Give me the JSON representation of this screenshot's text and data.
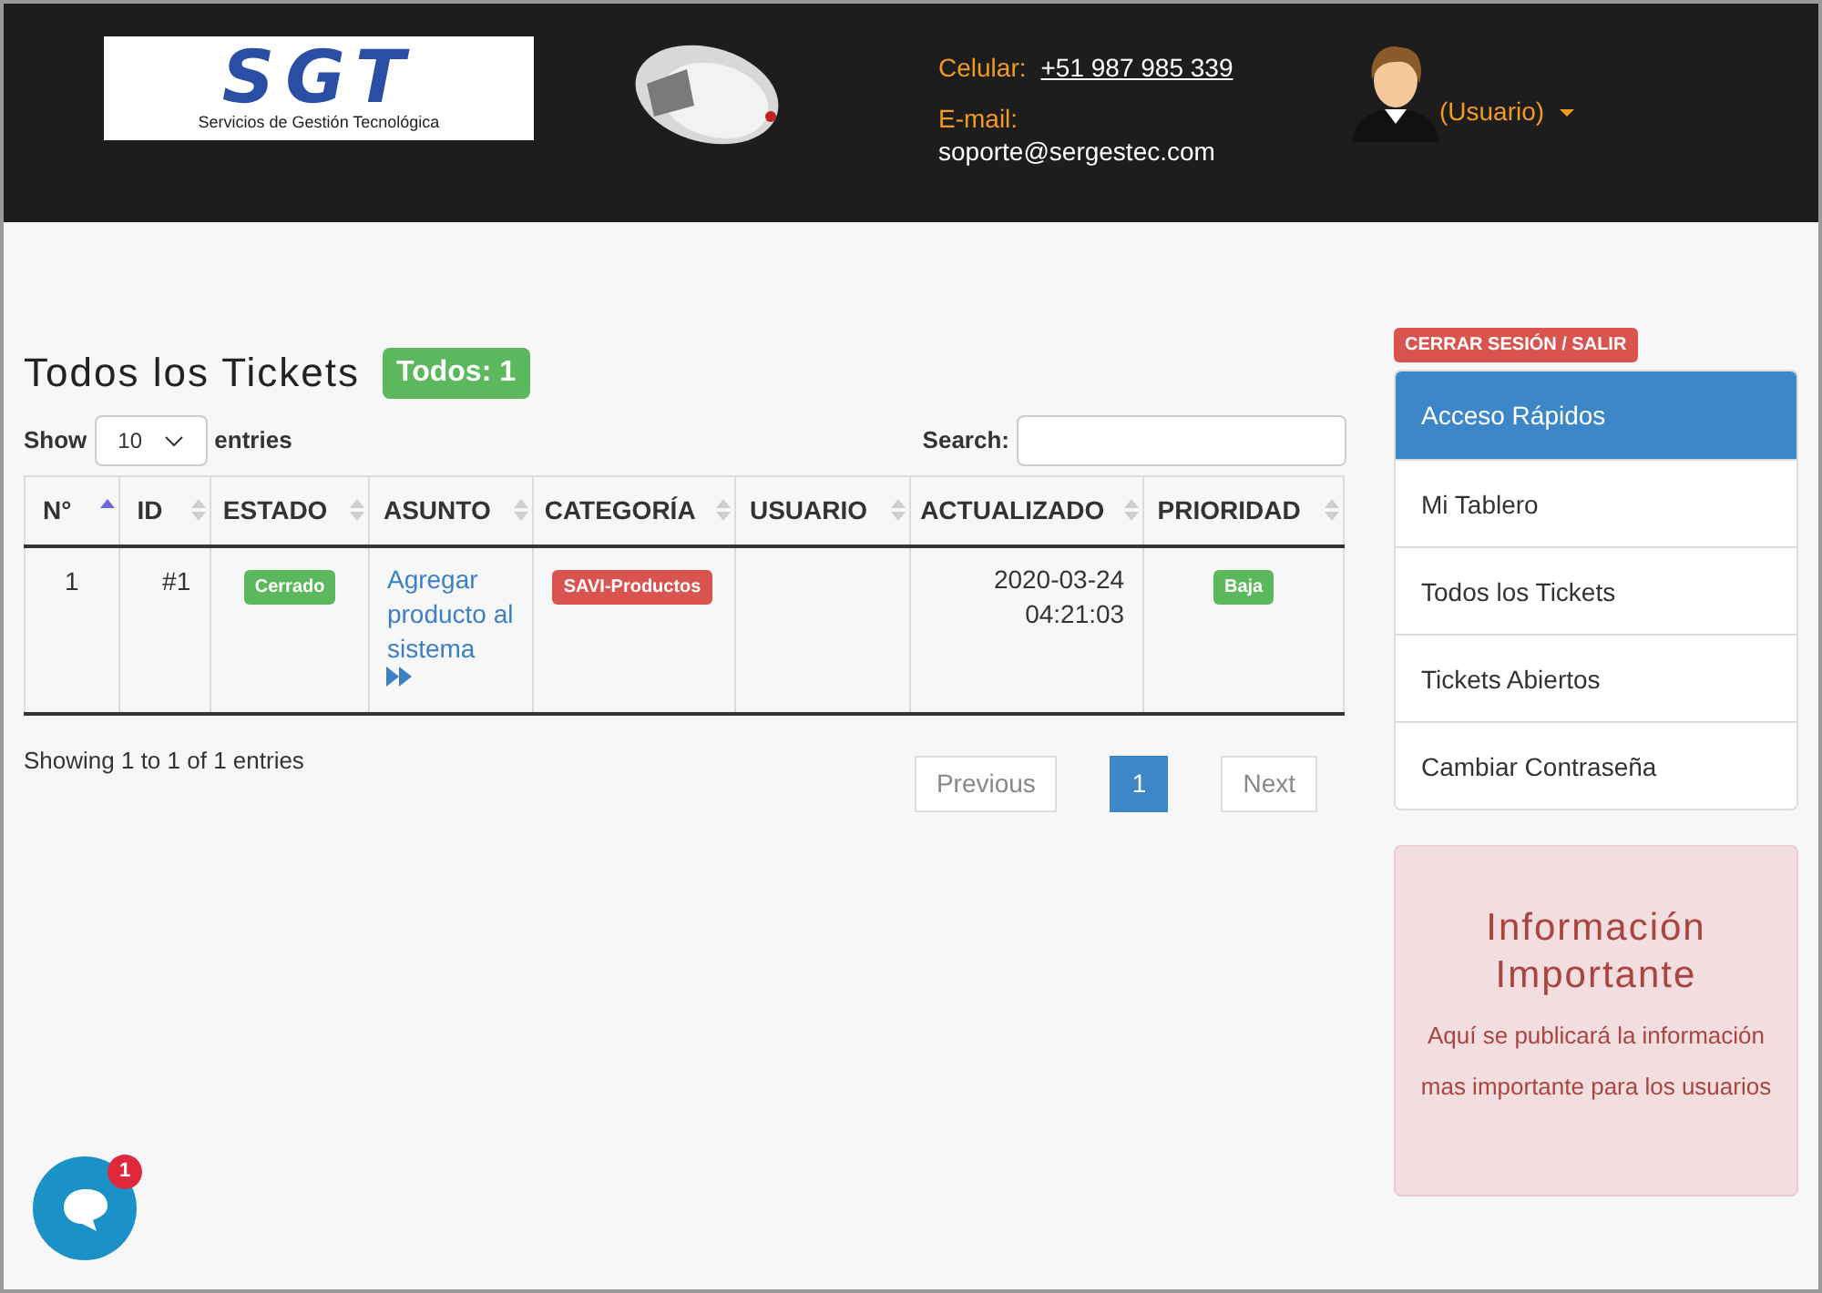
{
  "header": {
    "logo": {
      "mark": "SGT",
      "tagline": "Servicios de Gestión Tecnológica"
    },
    "phone_label": "Celular:",
    "phone": "+51 987 985 339",
    "email_label": "E-mail:",
    "email": "soporte@sergestec.com",
    "user_menu": "(Usuario)"
  },
  "page": {
    "title": "Todos los Tickets",
    "count_badge": "Todos: 1"
  },
  "length_control": {
    "before": "Show",
    "value": "10",
    "after": "entries"
  },
  "search": {
    "label": "Search:"
  },
  "table": {
    "columns": [
      {
        "label": "N°",
        "sorted": true
      },
      {
        "label": "ID",
        "sorted": false
      },
      {
        "label": "ESTADO",
        "sorted": false
      },
      {
        "label": "ASUNTO",
        "sorted": false
      },
      {
        "label": "CATEGORÍA",
        "sorted": false
      },
      {
        "label": "USUARIO",
        "sorted": false
      },
      {
        "label": "ACTUALIZADO",
        "sorted": false
      },
      {
        "label": "PRIORIDAD",
        "sorted": false
      }
    ],
    "rows": [
      {
        "n": "1",
        "id": "#1",
        "estado": {
          "text": "Cerrado",
          "color": "#5cb85c"
        },
        "asunto": "Agregar producto al sistema",
        "categoria": {
          "text": "SAVI-Productos",
          "color": "#d9534f"
        },
        "actualizado_date": "2020-03-24",
        "actualizado_time": "04:21:03",
        "prioridad": {
          "text": "Baja",
          "color": "#5cb85c"
        }
      }
    ]
  },
  "info": "Showing 1 to 1 of 1 entries",
  "pagination": [
    {
      "label": "Previous",
      "disabled": true,
      "selected": false
    },
    {
      "label": "1",
      "disabled": false,
      "selected": true
    },
    {
      "label": "Next",
      "disabled": true,
      "selected": false
    }
  ],
  "logout_button": "CERRAR SESIÓN / SALIR",
  "sidebar": {
    "items": [
      {
        "label": "Acceso Rápidos",
        "selected": true
      },
      {
        "label": "Mi Tablero",
        "selected": false
      },
      {
        "label": "Todos los Tickets",
        "selected": false
      },
      {
        "label": "Tickets Abiertos",
        "selected": false
      },
      {
        "label": "Cambiar Contraseña",
        "selected": false
      }
    ]
  },
  "notice": {
    "title": "Información Importante",
    "body": "Aquí se publicará la información mas importante para los usuarios"
  },
  "chat": {
    "badge": "1"
  }
}
